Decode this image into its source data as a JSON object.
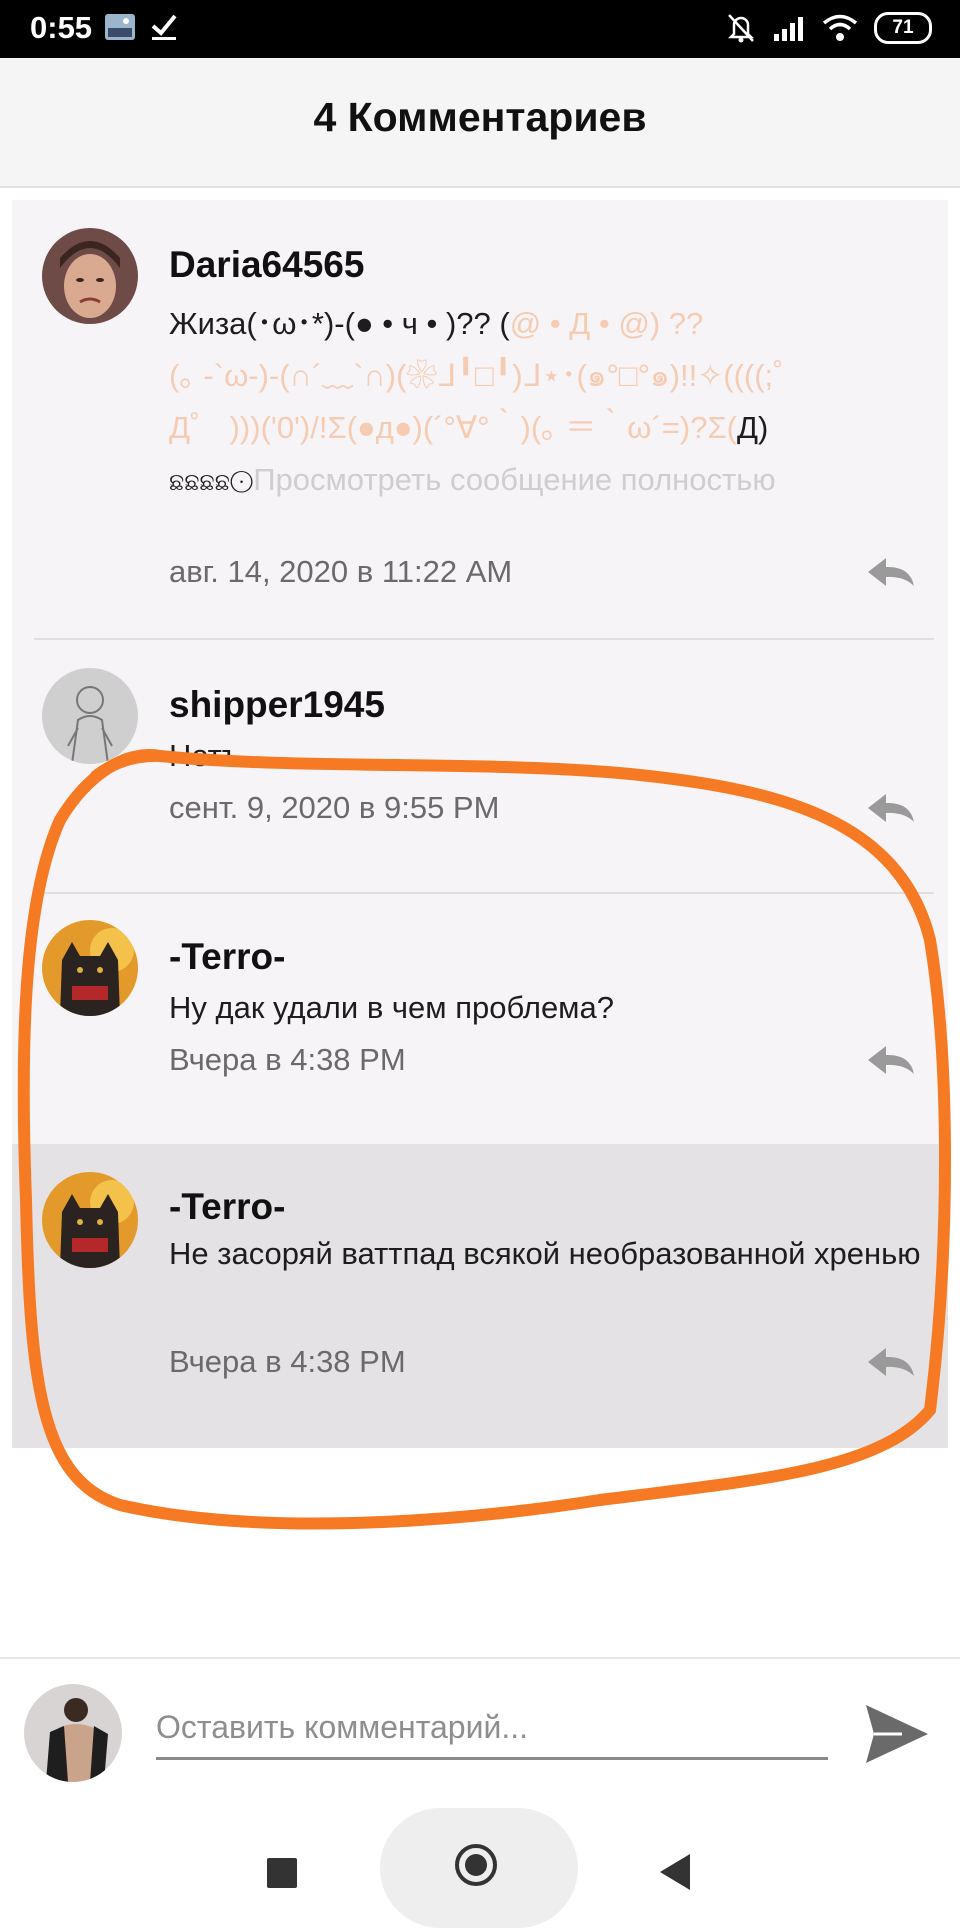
{
  "status_bar": {
    "time": "0:55",
    "battery": "71",
    "icons": [
      "photo-icon",
      "check-icon",
      "bell-off-icon",
      "signal-icon",
      "wifi-icon",
      "battery-icon"
    ]
  },
  "header": {
    "title": "4 Комментариев"
  },
  "comments": [
    {
      "author": "Daria64565",
      "text_dark": "Жиза(･ω･*)-(● • ч • )?? (",
      "text_faded_1": "@ • Д • @)  ??",
      "text_faded_2": "(｡ -`ω-)-(∩´﹏`∩)(❀ᒧ╹□╹)ᒧ⋆･(๑°□°๑)!!✧((((;゜",
      "text_faded_3": "Д゜ )))('0')/!Σ(●д●)(´°∀°｀)(｡ ＝｀ω´=)?Σ(",
      "text_dark_end": "Д)",
      "text_emoji": "ଛଛଛଛ⨀",
      "show_more": "Просмотреть сообщение полностью",
      "date": "авг. 14, 2020 в 11:22 AM"
    },
    {
      "author": "shipper1945",
      "text": "Нетъ",
      "date": "сент. 9, 2020 в 9:55 PM"
    },
    {
      "author": "-Terro-",
      "text": "Ну дак удали в чем проблема?",
      "date": "Вчера в 4:38 PM"
    },
    {
      "author": "-Terro-",
      "text": "Не засоряй ваттпад всякой необразованной хренью",
      "date": "Вчера в 4:38 PM"
    }
  ],
  "composer": {
    "placeholder": "Оставить комментарий..."
  },
  "colors": {
    "annotation": "#f57a23",
    "selected_row": "#e4e2e4",
    "list_bg": "#f6f4f6"
  }
}
